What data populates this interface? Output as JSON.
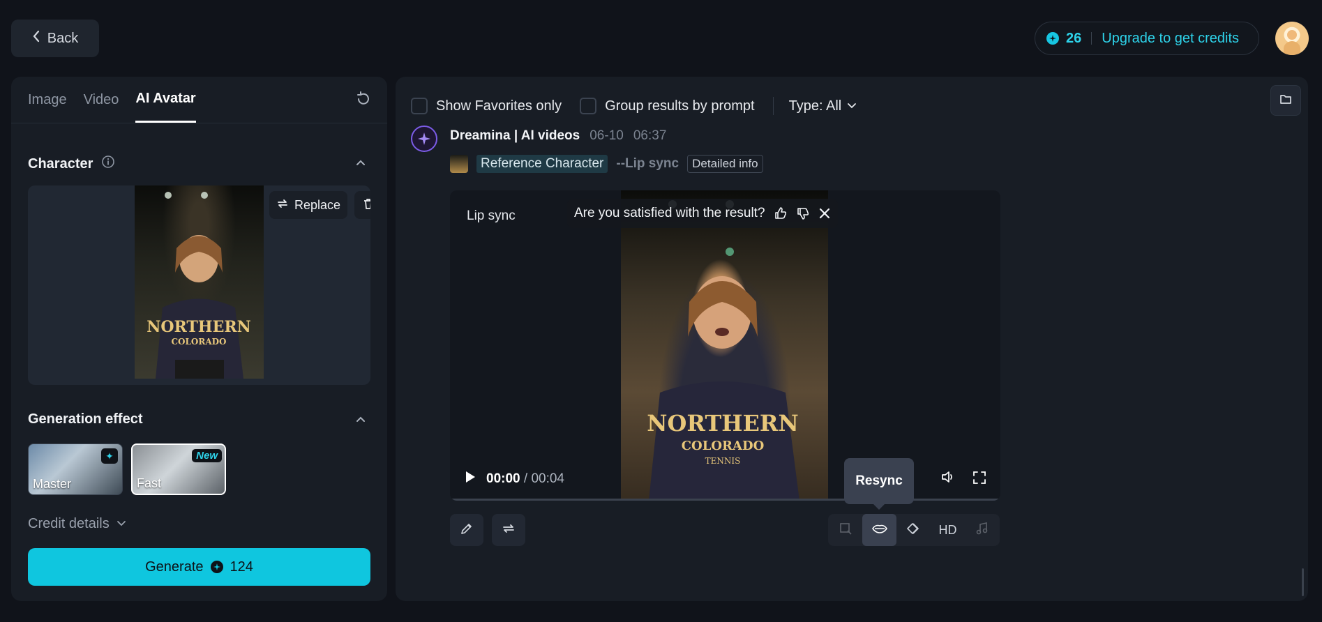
{
  "header": {
    "back_label": "Back",
    "credits": "26",
    "upgrade_label": "Upgrade to get credits"
  },
  "left": {
    "tabs": [
      {
        "label": "Image",
        "active": false
      },
      {
        "label": "Video",
        "active": false
      },
      {
        "label": "AI Avatar",
        "active": true
      }
    ],
    "character": {
      "title": "Character",
      "replace_label": "Replace"
    },
    "generation": {
      "title": "Generation effect",
      "options": [
        {
          "label": "Master",
          "badge": "sparkle-icon",
          "selected": false
        },
        {
          "label": "Fast",
          "badge": "New",
          "selected": true
        }
      ]
    },
    "credit_details_label": "Credit details",
    "generate": {
      "label": "Generate",
      "cost": "124"
    }
  },
  "right": {
    "filters": {
      "favorites_label": "Show Favorites only",
      "group_label": "Group results by prompt",
      "type_label": "Type: All"
    },
    "post": {
      "author": "Dreamina | AI videos",
      "date": "06-10",
      "time": "06:37",
      "reference_label": "Reference Character",
      "mode_label": "--Lip sync",
      "detail_label": "Detailed info"
    },
    "video": {
      "mode_label": "Lip sync",
      "feedback_question": "Are you satisfied with the result?",
      "time_current": "00:00",
      "time_separator": "/",
      "time_total": "00:04",
      "progress": 0
    },
    "tooltip": "Resync",
    "toolbar": {
      "hd_label": "HD"
    }
  },
  "colors": {
    "accent": "#0fc6df",
    "background": "#10131a",
    "panel": "#181d25"
  }
}
